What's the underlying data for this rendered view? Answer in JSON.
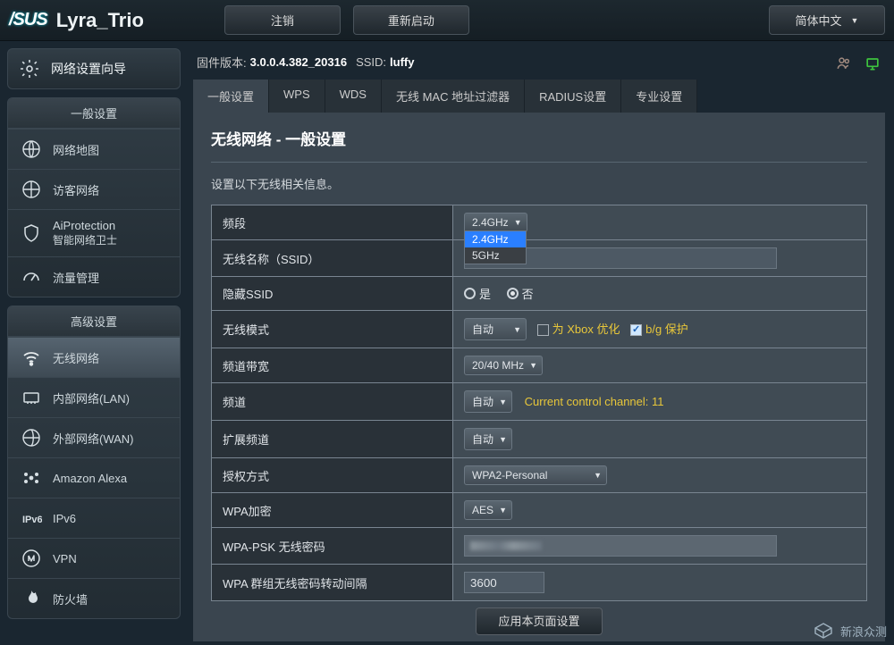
{
  "header": {
    "brand": "/SUS",
    "model": "Lyra_Trio",
    "logout": "注销",
    "reboot": "重新启动",
    "language": "简体中文"
  },
  "infobar": {
    "fw_label": "固件版本:",
    "fw_value": "3.0.0.4.382_20316",
    "ssid_label": "SSID:",
    "ssid_value": "luffy"
  },
  "sidebar": {
    "wizard": "网络设置向导",
    "groups": [
      {
        "title": "一般设置",
        "items": [
          {
            "name": "network-map",
            "label": "网络地图"
          },
          {
            "name": "guest-network",
            "label": "访客网络"
          },
          {
            "name": "ai-protection",
            "label": "AiProtection",
            "sub": "智能网络卫士"
          },
          {
            "name": "traffic",
            "label": "流量管理"
          }
        ]
      },
      {
        "title": "高级设置",
        "items": [
          {
            "name": "wireless",
            "label": "无线网络",
            "active": true
          },
          {
            "name": "lan",
            "label": "内部网络(LAN)"
          },
          {
            "name": "wan",
            "label": "外部网络(WAN)"
          },
          {
            "name": "alexa",
            "label": "Amazon Alexa"
          },
          {
            "name": "ipv6",
            "label": "IPv6"
          },
          {
            "name": "vpn",
            "label": "VPN"
          },
          {
            "name": "firewall",
            "label": "防火墙"
          }
        ]
      }
    ]
  },
  "tabs": [
    {
      "label": "一般设置",
      "active": true
    },
    {
      "label": "WPS"
    },
    {
      "label": "WDS"
    },
    {
      "label": "无线 MAC 地址过滤器"
    },
    {
      "label": "RADIUS设置"
    },
    {
      "label": "专业设置"
    }
  ],
  "panel": {
    "title": "无线网络 - 一般设置",
    "desc": "设置以下无线相关信息。"
  },
  "form": {
    "band": {
      "label": "频段",
      "value": "2.4GHz",
      "options": [
        "2.4GHz",
        "5GHz"
      ]
    },
    "ssid": {
      "label": "无线名称（SSID）",
      "value": ""
    },
    "hide_ssid": {
      "label": "隐藏SSID",
      "yes": "是",
      "no": "否",
      "selected": "no"
    },
    "mode": {
      "label": "无线模式",
      "value": "自动",
      "xbox": "为 Xbox 优化",
      "bg": "b/g 保护",
      "bg_checked": true
    },
    "bandwidth": {
      "label": "频道带宽",
      "value": "20/40 MHz"
    },
    "channel": {
      "label": "频道",
      "value": "自动",
      "hint": "Current control channel: 11"
    },
    "ext_channel": {
      "label": "扩展频道",
      "value": "自动"
    },
    "auth": {
      "label": "授权方式",
      "value": "WPA2-Personal"
    },
    "wpa_enc": {
      "label": "WPA加密",
      "value": "AES"
    },
    "wpa_psk": {
      "label": "WPA-PSK 无线密码"
    },
    "wpa_rekey": {
      "label": "WPA 群组无线密码转动间隔",
      "value": "3600"
    }
  },
  "apply_label": "应用本页面设置",
  "watermark": "新浪众测"
}
